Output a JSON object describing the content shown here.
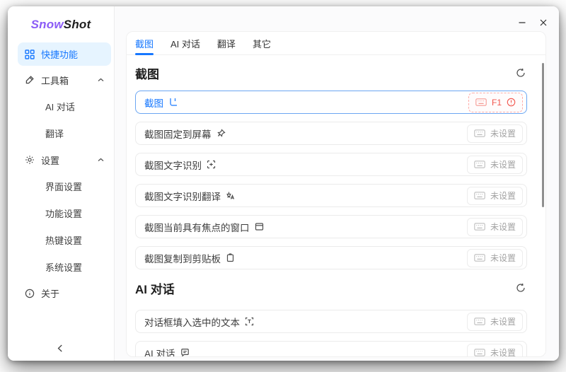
{
  "app": {
    "logo_primary": "Snow",
    "logo_secondary": "Shot"
  },
  "window_controls": {
    "minimize": "minimize",
    "close": "close"
  },
  "sidebar": {
    "items": [
      {
        "label": "快捷功能",
        "icon": "grid-icon",
        "active": true
      },
      {
        "label": "工具箱",
        "icon": "tool-icon",
        "expanded": true
      },
      {
        "label": "AI 对话"
      },
      {
        "label": "翻译"
      },
      {
        "label": "设置",
        "icon": "gear-icon",
        "expanded": true
      },
      {
        "label": "界面设置"
      },
      {
        "label": "功能设置"
      },
      {
        "label": "热键设置"
      },
      {
        "label": "系统设置"
      },
      {
        "label": "关于",
        "icon": "info-icon"
      }
    ]
  },
  "tabs": [
    {
      "label": "截图",
      "active": true
    },
    {
      "label": "AI 对话"
    },
    {
      "label": "翻译"
    },
    {
      "label": "其它"
    }
  ],
  "sections": [
    {
      "title": "截图",
      "refresh_icon": "refresh-icon",
      "rows": [
        {
          "label": "截图",
          "icon": "crop-icon",
          "hotkey": "F1",
          "status": "conflict",
          "active": true
        },
        {
          "label": "截图固定到屏幕",
          "icon": "pin-icon",
          "hotkey_placeholder": "未设置"
        },
        {
          "label": "截图文字识别",
          "icon": "ocr-icon",
          "hotkey_placeholder": "未设置"
        },
        {
          "label": "截图文字识别翻译",
          "icon": "translate-icon",
          "hotkey_placeholder": "未设置"
        },
        {
          "label": "截图当前具有焦点的窗口",
          "icon": "window-icon",
          "hotkey_placeholder": "未设置"
        },
        {
          "label": "截图复制到剪贴板",
          "icon": "clipboard-icon",
          "hotkey_placeholder": "未设置"
        }
      ]
    },
    {
      "title": "AI 对话",
      "refresh_icon": "refresh-icon",
      "rows": [
        {
          "label": "对话框填入选中的文本",
          "icon": "text-select-icon",
          "hotkey_placeholder": "未设置"
        },
        {
          "label": "AI 对话",
          "icon": "chat-icon",
          "hotkey_placeholder": "未设置"
        }
      ]
    }
  ],
  "colors": {
    "accent": "#1677ff",
    "accent_bg": "#e6f4ff",
    "danger": "#f2554d",
    "danger_border": "#ffaca8",
    "row_border": "#ebebeb",
    "muted_text": "#a3a3a3"
  }
}
